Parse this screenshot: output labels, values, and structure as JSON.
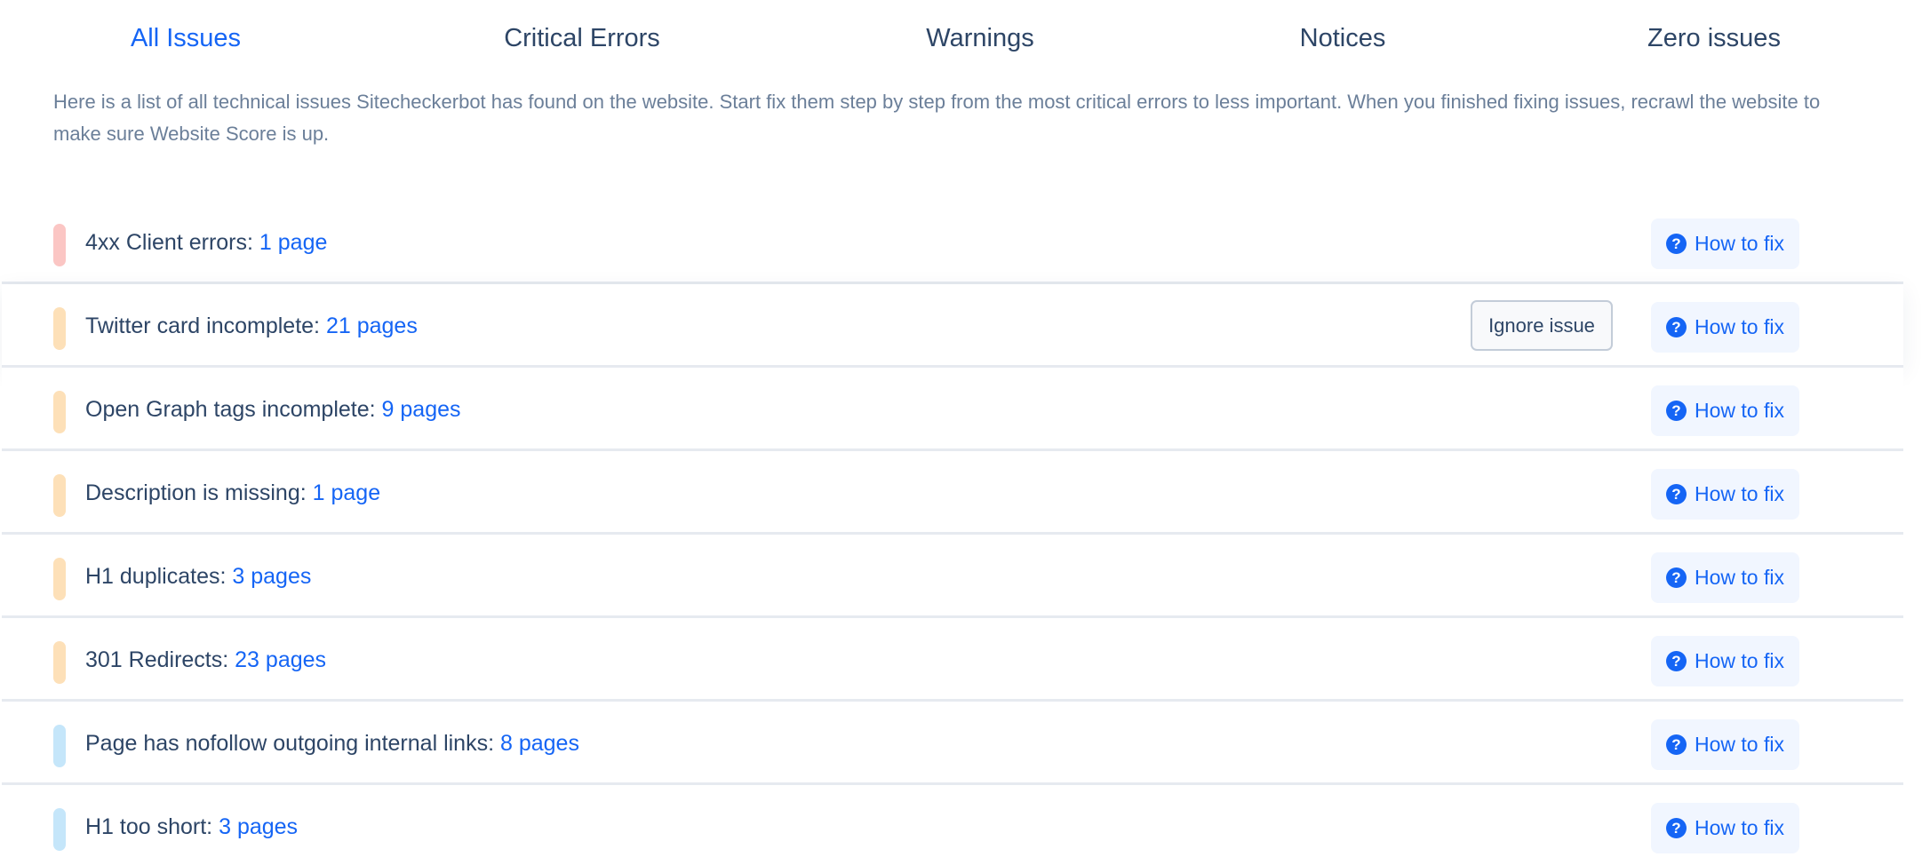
{
  "tabs": [
    {
      "label": "All Issues",
      "active": true
    },
    {
      "label": "Critical Errors",
      "active": false
    },
    {
      "label": "Warnings",
      "active": false
    },
    {
      "label": "Notices",
      "active": false
    },
    {
      "label": "Zero issues",
      "active": false
    }
  ],
  "description": "Here is a list of all technical issues Sitecheckerbot has found on the website. Start fix them step by step from the most critical errors to less important. When you finished fixing issues, recrawl the website to make sure Website Score is up.",
  "colors": {
    "accent": "#1565f5",
    "critical": "#fbc6c4",
    "warning": "#fde0b8",
    "notice": "#c5e6fa",
    "text": "#2d4566"
  },
  "actions": {
    "how_to_fix_label": "How to fix",
    "how_to_fix_icon": "question-circle-icon",
    "ignore_label": "Ignore issue"
  },
  "issues": [
    {
      "title": "4xx Client errors:",
      "count": "1 page",
      "severity": "critical",
      "hovered": false
    },
    {
      "title": "Twitter card incomplete:",
      "count": "21 pages",
      "severity": "warning",
      "hovered": true
    },
    {
      "title": "Open Graph tags incomplete:",
      "count": "9 pages",
      "severity": "warning",
      "hovered": false
    },
    {
      "title": "Description is missing:",
      "count": "1 page",
      "severity": "warning",
      "hovered": false
    },
    {
      "title": "H1 duplicates:",
      "count": "3 pages",
      "severity": "warning",
      "hovered": false
    },
    {
      "title": "301 Redirects:",
      "count": "23 pages",
      "severity": "warning",
      "hovered": false
    },
    {
      "title": "Page has nofollow outgoing internal links:",
      "count": "8 pages",
      "severity": "notice",
      "hovered": false
    },
    {
      "title": "H1 too short:",
      "count": "3 pages",
      "severity": "notice",
      "hovered": false
    }
  ]
}
